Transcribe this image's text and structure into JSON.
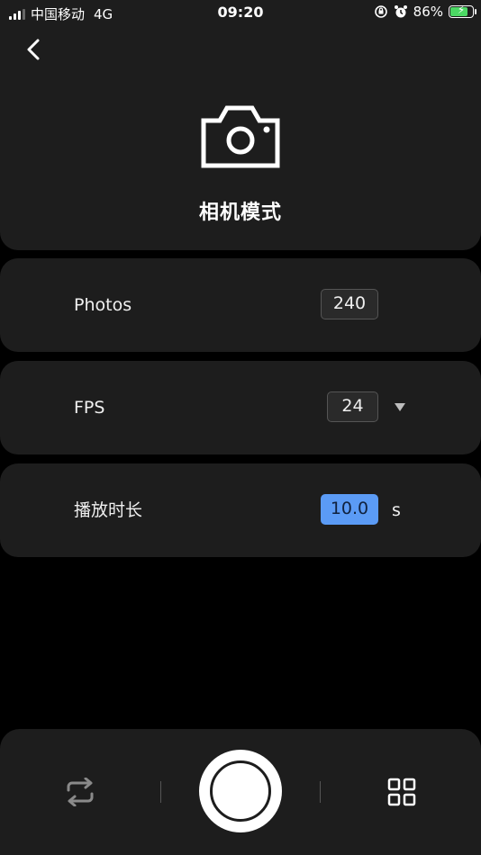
{
  "status_bar": {
    "carrier": "中国移动",
    "network": "4G",
    "time": "09:20",
    "battery_percent": "86%",
    "battery_level": 0.86,
    "icons": [
      "signal-icon",
      "rotation-lock-icon",
      "alarm-icon",
      "battery-charging-icon"
    ]
  },
  "header": {
    "back_icon": "chevron-left-icon",
    "mode_icon": "camera-icon",
    "title": "相机模式"
  },
  "settings": {
    "photos": {
      "label": "Photos",
      "value": "240"
    },
    "fps": {
      "label": "FPS",
      "value": "24",
      "icon": "caret-down-icon"
    },
    "duration": {
      "label": "播放时长",
      "value": "10.0",
      "unit": "s"
    }
  },
  "bottom_bar": {
    "icons": [
      "switch-camera-icon",
      "shutter-button",
      "grid-icon"
    ]
  },
  "colors": {
    "background": "#000000",
    "card": "#1d1d1d",
    "accent": "#5b9bf5",
    "battery": "#4cd964"
  }
}
